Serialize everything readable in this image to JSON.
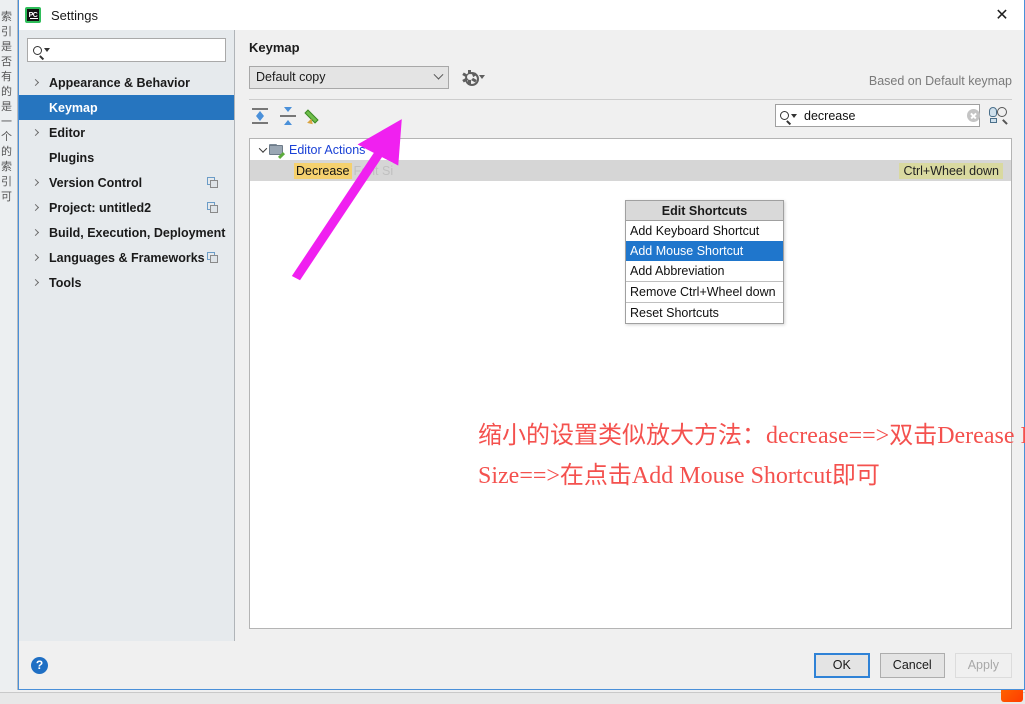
{
  "window": {
    "title": "Settings",
    "logo_text": "PC",
    "close_label": "✕"
  },
  "sidebar": {
    "search_placeholder": "",
    "search_value": "",
    "search_icon": "search-icon",
    "items": [
      {
        "label": "Appearance & Behavior",
        "expandable": true,
        "selected": false,
        "copy": false
      },
      {
        "label": "Keymap",
        "expandable": false,
        "selected": true,
        "copy": false
      },
      {
        "label": "Editor",
        "expandable": true,
        "selected": false,
        "copy": false
      },
      {
        "label": "Plugins",
        "expandable": false,
        "selected": false,
        "copy": false
      },
      {
        "label": "Version Control",
        "expandable": true,
        "selected": false,
        "copy": true
      },
      {
        "label": "Project: untitled2",
        "expandable": true,
        "selected": false,
        "copy": true
      },
      {
        "label": "Build, Execution, Deployment",
        "expandable": true,
        "selected": false,
        "copy": false
      },
      {
        "label": "Languages & Frameworks",
        "expandable": true,
        "selected": false,
        "copy": true
      },
      {
        "label": "Tools",
        "expandable": true,
        "selected": false,
        "copy": false
      }
    ]
  },
  "content": {
    "page_title": "Keymap",
    "keymap_selected": "Default copy",
    "gear_icon": "gear-icon",
    "based_on": "Based on Default keymap",
    "toolbar": {
      "expand_all_icon": "expand-all-icon",
      "collapse_all_icon": "collapse-all-icon",
      "edit_icon": "pencil-edit-icon"
    },
    "find": {
      "value": "decrease",
      "placeholder": "",
      "clear_icon": "clear-circle-icon",
      "shortcut_search_icon": "find-by-shortcut-icon"
    },
    "tree": {
      "group_label": "Editor Actions",
      "group_icon": "editor-actions-folder-icon",
      "row": {
        "match_text": "Decrease",
        "rest_text": "Font Si",
        "shortcut_badge": "Ctrl+Wheel down"
      }
    }
  },
  "context_menu": {
    "title": "Edit Shortcuts",
    "items": [
      {
        "label": "Add Keyboard Shortcut",
        "active": false,
        "separator_after": false
      },
      {
        "label": "Add Mouse Shortcut",
        "active": true,
        "separator_after": false
      },
      {
        "label": "Add Abbreviation",
        "active": false,
        "separator_after": true
      },
      {
        "label": "Remove Ctrl+Wheel down",
        "active": false,
        "separator_after": true
      },
      {
        "label": "Reset Shortcuts",
        "active": false,
        "separator_after": false
      }
    ]
  },
  "annotation": {
    "line1": "缩小的设置类似放大方法：decrease==>双击Derease Font",
    "line2": "Size==>在点击Add Mouse Shortcut即可",
    "color": "#f4514e",
    "arrow_color": "#f020f0"
  },
  "footer": {
    "help_icon": "help-question-icon",
    "ok_label": "OK",
    "cancel_label": "Cancel",
    "apply_label": "Apply"
  },
  "background": {
    "side_text": "索引是否有的是一个的索引可"
  }
}
